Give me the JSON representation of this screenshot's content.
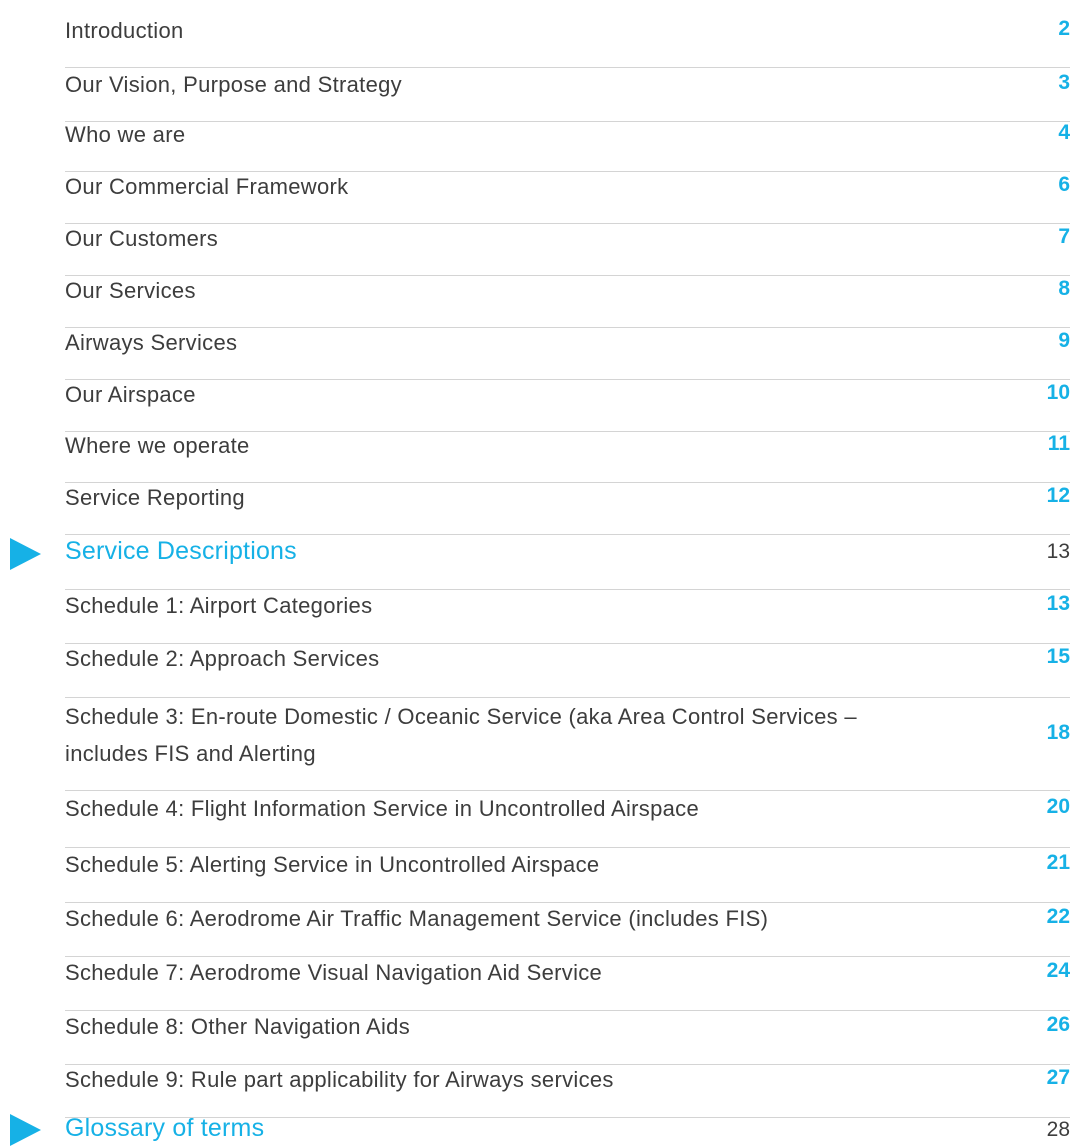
{
  "toc": {
    "entries": [
      {
        "title": "Introduction",
        "page": "2"
      },
      {
        "title": "Our Vision, Purpose and Strategy",
        "page": "3"
      },
      {
        "title": "Who we are",
        "page": "4"
      },
      {
        "title": "Our Commercial Framework",
        "page": "6"
      },
      {
        "title": "Our Customers",
        "page": "7"
      },
      {
        "title": "Our Services",
        "page": "8"
      },
      {
        "title": "Airways Services",
        "page": "9"
      },
      {
        "title": "Our Airspace",
        "page": "10"
      },
      {
        "title": "Where we operate",
        "page": "11"
      },
      {
        "title": "Service Reporting",
        "page": "12"
      }
    ],
    "section_service_descriptions": {
      "title": "Service Descriptions",
      "page": "13"
    },
    "schedules": [
      {
        "title": "Schedule 1: Airport Categories",
        "page": "13"
      },
      {
        "title": "Schedule 2: Approach Services",
        "page": "15"
      },
      {
        "title": "Schedule 3: En-route Domestic / Oceanic Service (aka Area Control Services – includes FIS and Alerting",
        "page": "18"
      },
      {
        "title": "Schedule 4: Flight Information Service in Uncontrolled Airspace",
        "page": "20"
      },
      {
        "title": "Schedule 5: Alerting Service in Uncontrolled Airspace",
        "page": "21"
      },
      {
        "title": "Schedule 6: Aerodrome Air Traffic Management Service (includes FIS)",
        "page": "22"
      },
      {
        "title": "Schedule 7: Aerodrome Visual Navigation Aid Service",
        "page": "24"
      },
      {
        "title": "Schedule 8: Other Navigation Aids",
        "page": "26"
      },
      {
        "title": "Schedule 9: Rule part applicability for Airways services",
        "page": "27"
      }
    ],
    "section_glossary": {
      "title": "Glossary of terms",
      "page": "28"
    }
  },
  "colors": {
    "accent": "#16b1e6",
    "text": "#3d3d3d",
    "divider": "#d4d4d4"
  }
}
